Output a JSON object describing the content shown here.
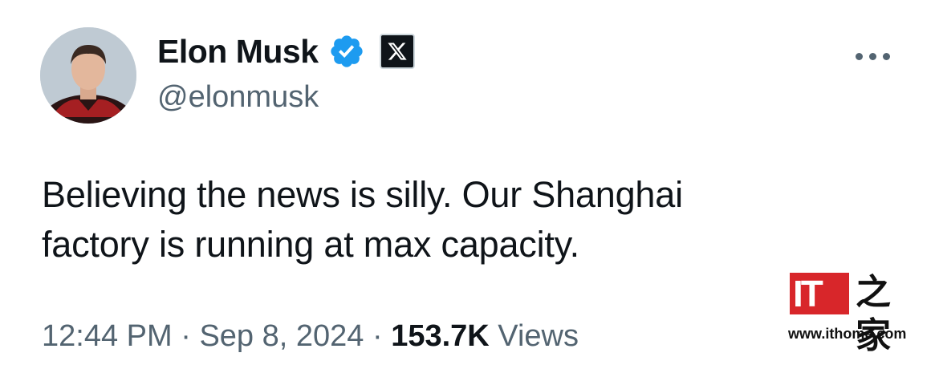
{
  "tweet": {
    "display_name": "Elon Musk",
    "handle": "@elonmusk",
    "text_line1": "Believing the news is silly. Our Shanghai",
    "text_line2": "factory is running at max capacity.",
    "time": "12:44 PM",
    "sep1": "·",
    "date": "Sep 8, 2024",
    "sep2": "·",
    "views_count": "153.7K",
    "views_label": "Views"
  },
  "icons": {
    "verified": "verified-badge-icon",
    "affiliation": "x-logo-icon",
    "more": "more-options-icon"
  },
  "colors": {
    "verified_blue": "#1d9bf0",
    "text_primary": "#0f1419",
    "text_secondary": "#536471",
    "watermark_red": "#d8262a"
  },
  "watermark": {
    "logo_text": "IT",
    "glyph": "之家",
    "url": "www.ithome.com"
  }
}
